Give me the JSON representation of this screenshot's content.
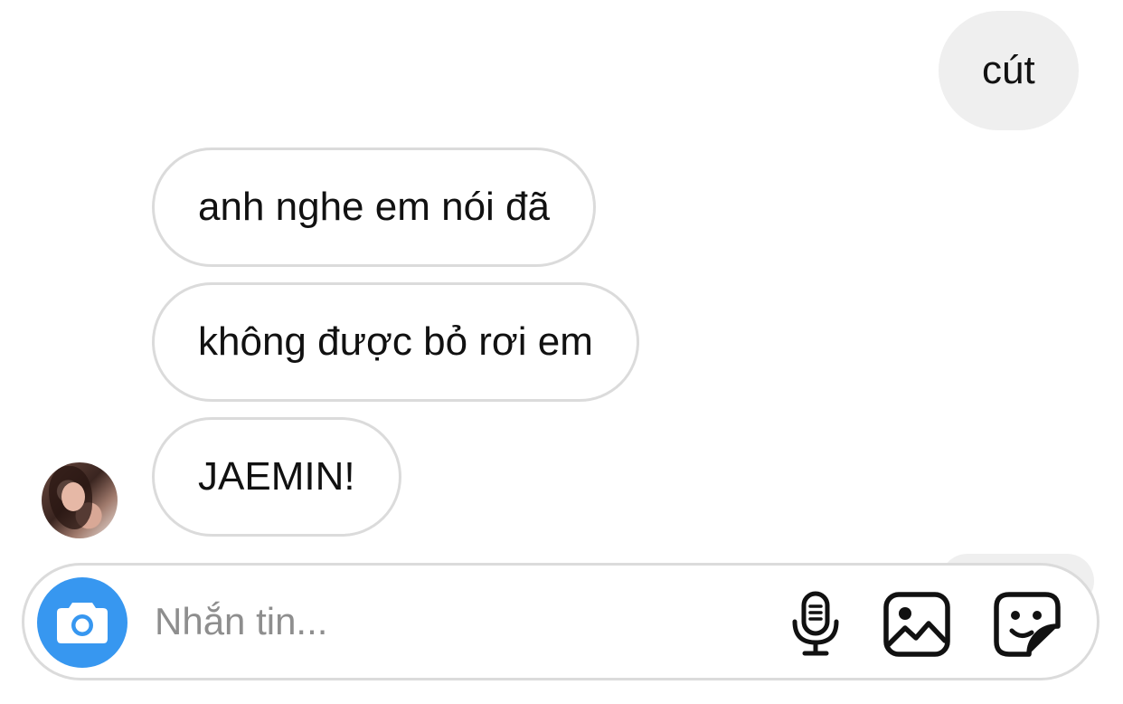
{
  "messages": [
    {
      "direction": "outgoing",
      "text": "cút"
    },
    {
      "direction": "incoming",
      "text": "anh nghe em nói đã"
    },
    {
      "direction": "incoming",
      "text": "không được bỏ rơi em"
    },
    {
      "direction": "incoming",
      "text": "JAEMIN!"
    }
  ],
  "composer": {
    "placeholder": "Nhắn tin...",
    "value": ""
  },
  "icons": {
    "camera": "camera-icon",
    "microphone": "microphone-icon",
    "gallery": "gallery-icon",
    "sticker": "sticker-icon"
  },
  "colors": {
    "accent": "#3797f0",
    "outgoing_bubble": "#efefef",
    "incoming_border": "#dbdbdb",
    "placeholder": "#8e8e8e"
  }
}
